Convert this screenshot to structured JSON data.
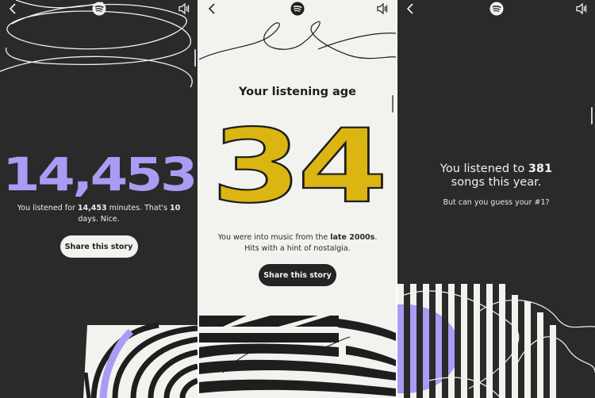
{
  "panels": [
    {
      "id": "minutes",
      "big_number": "14,453",
      "caption": {
        "pre": "You listened for ",
        "bold_minutes": "14,453",
        "mid": " minutes. That's ",
        "bold_days": "10",
        "post": " days. Nice."
      },
      "share_label": "Share this story"
    },
    {
      "id": "listening-age",
      "title": "Your listening age",
      "age": "34",
      "caption": {
        "pre": "You were into music from the ",
        "bold_era": "late 2000s",
        "post": ". Hits with a hint of nostalgia."
      },
      "share_label": "Share this story"
    },
    {
      "id": "songs",
      "line_pre": "You listened to ",
      "bold_count": "381",
      "line_post": " songs this year.",
      "question": "But can you guess your #1?"
    }
  ],
  "icons": {
    "back": "chevron-left-icon",
    "logo": "spotify-logo-icon",
    "sound": "speaker-muted-icon"
  },
  "colors": {
    "dark_bg": "#2a2a2a",
    "light_bg": "#f2f2ee",
    "purple": "#a99cf4",
    "yellow": "#dbb612",
    "button_light": "#f2f2ee",
    "button_dark": "#242424"
  }
}
